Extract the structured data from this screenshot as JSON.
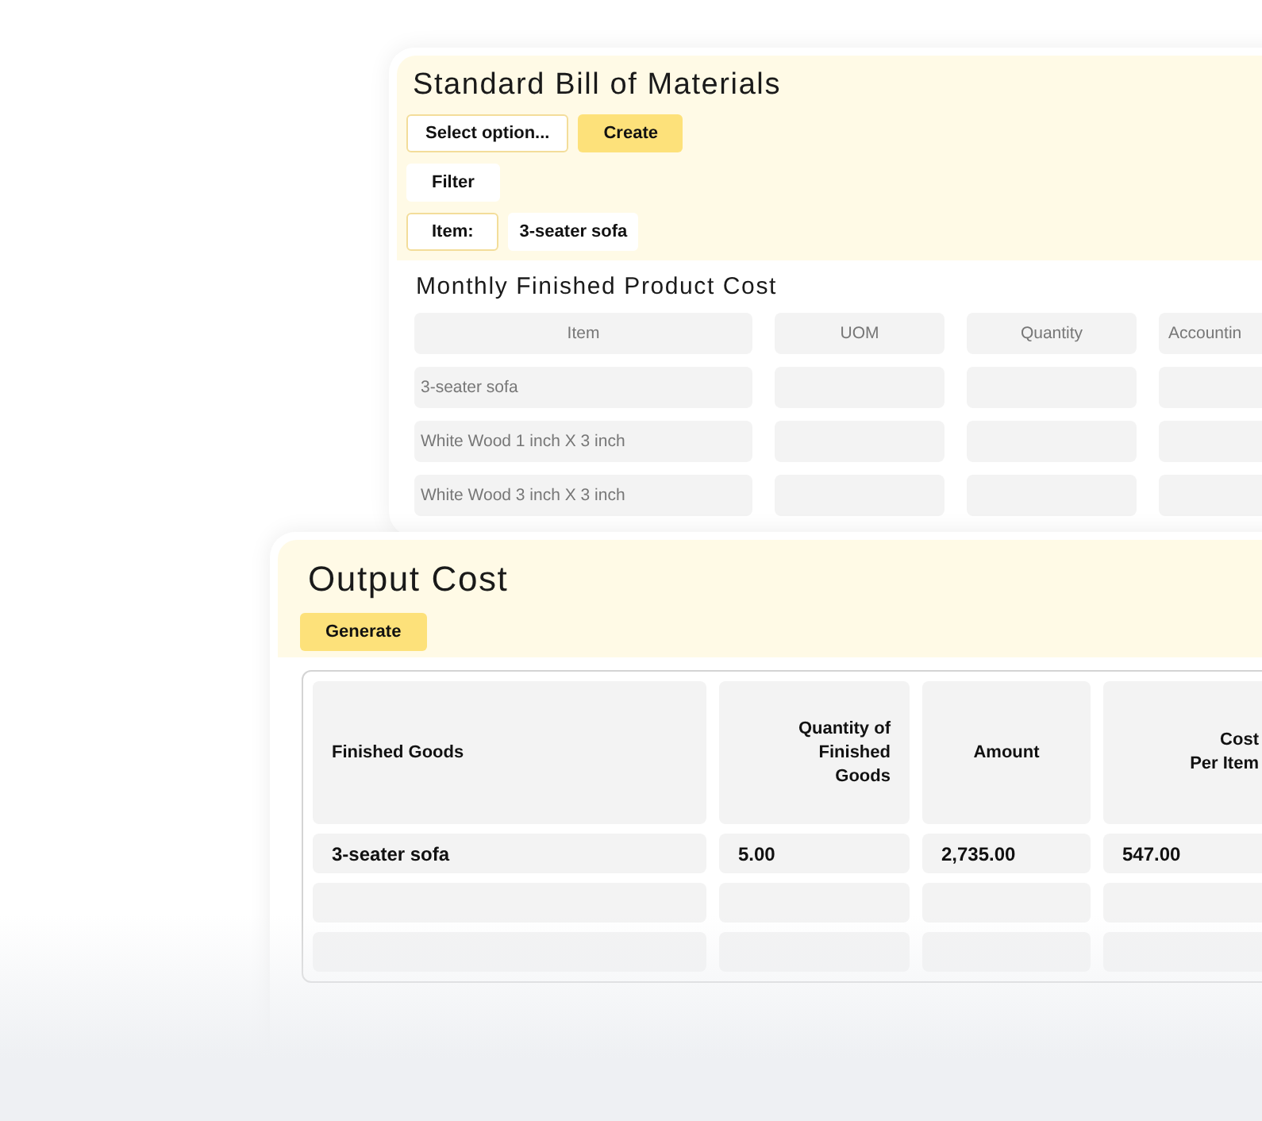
{
  "bom_panel": {
    "title": "Standard Bill of Materials",
    "select": {
      "placeholder": "Select option..."
    },
    "create_button": "Create",
    "filter_button": "Filter",
    "item_filter": {
      "label": "Item:",
      "value": "3-seater sofa"
    }
  },
  "monthly_cost": {
    "title": "Monthly Finished Product Cost",
    "columns": [
      "Item",
      "UOM",
      "Quantity",
      "Accountin"
    ],
    "rows": [
      {
        "item": "3-seater sofa"
      },
      {
        "item": "White Wood 1 inch X 3 inch"
      },
      {
        "item": "White Wood 3 inch X 3 inch"
      }
    ]
  },
  "output_cost": {
    "title": "Output Cost",
    "generate_button": "Generate",
    "columns": [
      "Finished Goods",
      "Quantity of\nFinished\nGoods",
      "Amount",
      "Cost\nPer Item"
    ],
    "rows": [
      {
        "cells": [
          "3-seater sofa",
          "5.00",
          "2,735.00",
          "547.00"
        ]
      }
    ]
  }
}
